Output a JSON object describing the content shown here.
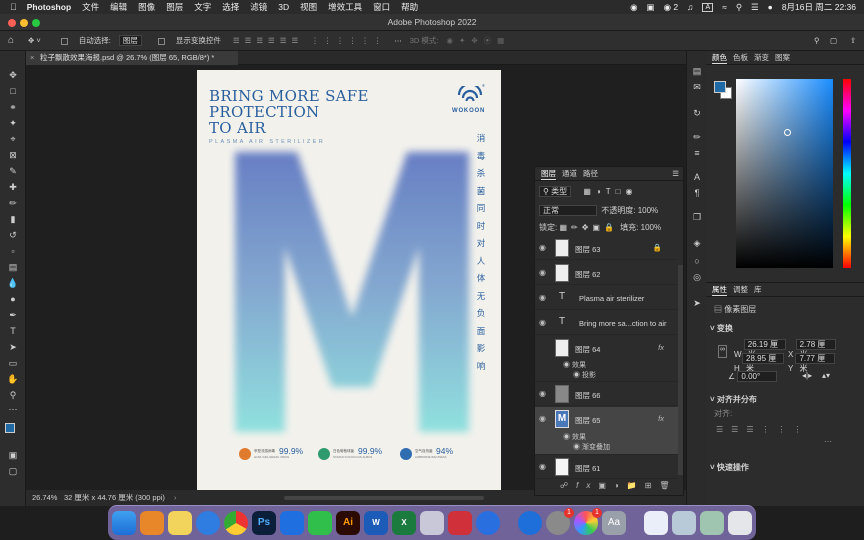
{
  "menubar": {
    "app": "Photoshop",
    "items": [
      "文件",
      "编辑",
      "图像",
      "图层",
      "文字",
      "选择",
      "滤镜",
      "3D",
      "视图",
      "增效工具",
      "窗口",
      "帮助"
    ],
    "wechat_count": "2",
    "input_method": "A",
    "date_time": "8月16日 周二 22:36"
  },
  "window": {
    "title": "Adobe Photoshop 2022"
  },
  "options": {
    "auto_select_label": "自动选择:",
    "auto_select_value": "图层",
    "show_transform_label": "显示变换控件",
    "mode_3d_label": "3D 模式:"
  },
  "document": {
    "tab_title": "粒子飘散效果海报.psd @ 26.7% (图层 65, RGB/8*) *",
    "zoom": "26.74%",
    "doc_info": "32 厘米 x 44.76 厘米 (300 ppi)"
  },
  "poster": {
    "headline_1": "BRING MORE SAFE",
    "headline_2": "PROTECTION",
    "headline_3": "TO AIR",
    "subtitle": "PLASMA AIR STERILIZER",
    "logo_text": "WOKOON",
    "registered": "®",
    "big_letter": "M",
    "vertical_text": [
      "消",
      "毒",
      "杀",
      "菌",
      "同",
      "时",
      "对",
      "人",
      "体",
      "无",
      "负",
      "面",
      "影",
      "响"
    ],
    "stats": [
      {
        "cn": "甲型流感病毒",
        "en": "H1N1 INFLUENZA VIRUS",
        "value": "99.9%",
        "color": "#e07a2d"
      },
      {
        "cn": "白色葡萄球菌",
        "en": "STAPHYLOCOCCUS ALBUS",
        "value": "99.9%",
        "color": "#2f9a6e"
      },
      {
        "cn": "空气自然菌",
        "en": "AIRBORNE BACTERIA",
        "value": "94%",
        "color": "#2e6db0"
      }
    ],
    "brand_color": "#2a5f9e"
  },
  "layers_panel": {
    "tabs": [
      "图层",
      "通道",
      "路径"
    ],
    "filter_label": "类型",
    "blend_mode": "正常",
    "opacity_label": "不透明度:",
    "opacity_value": "100%",
    "lock_label": "锁定:",
    "fill_label": "填充:",
    "fill_value": "100%",
    "layers": [
      {
        "name": "图层 63",
        "visible": true,
        "locked": true
      },
      {
        "name": "图层 62",
        "visible": true
      },
      {
        "name": "Plasma air sterilizer",
        "visible": true,
        "type": "text"
      },
      {
        "name": "Bring more sa...ction  to air",
        "visible": true,
        "type": "text"
      },
      {
        "name": "图层 64",
        "visible": false,
        "fx": "fx"
      },
      {
        "name": "图层 66",
        "visible": true
      },
      {
        "name": "图层 65",
        "visible": true,
        "fx": "fx",
        "selected": true
      },
      {
        "name": "图层 61",
        "visible": true
      }
    ],
    "layer64_effects_label": "效果",
    "layer64_effect": "投影",
    "layer65_effects_label": "效果",
    "layer65_effect": "渐变叠加"
  },
  "color_panel": {
    "tabs": [
      "颜色",
      "色板",
      "渐变",
      "图案"
    ],
    "foreground": "#1f6aa5",
    "background": "#ffffff"
  },
  "properties_panel": {
    "tabs": [
      "属性",
      "调整",
      "库"
    ],
    "kind": "像素图层",
    "transform_label": "变换",
    "w_label": "W",
    "w_value": "26.19 厘米",
    "x_label": "X",
    "x_value": "2.78 厘米",
    "h_label": "H",
    "h_value": "28.95 厘米",
    "y_label": "Y",
    "y_value": "7.77 厘米",
    "angle_value": "0.00°",
    "align_label": "对齐并分布",
    "align_sub": "对齐:",
    "quick_actions": "快速操作"
  },
  "dock": {
    "calendar_badge": "1",
    "appstore_badge": "1"
  }
}
